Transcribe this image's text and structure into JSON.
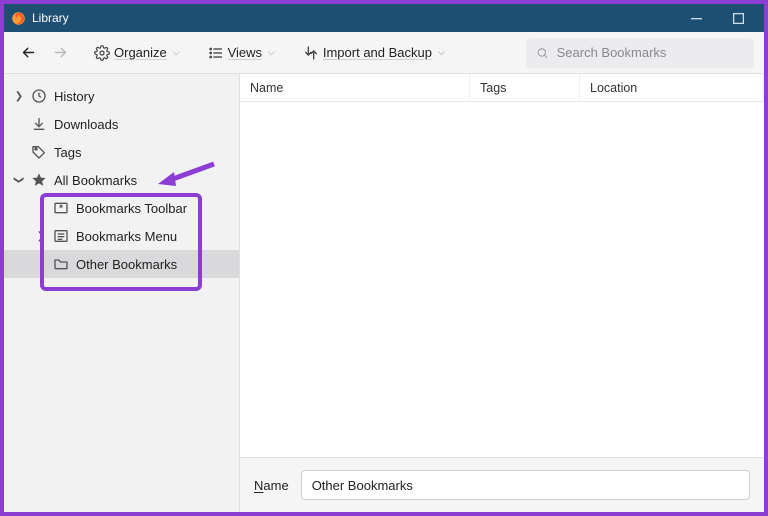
{
  "window": {
    "title": "Library"
  },
  "toolbar": {
    "organize": "Organize",
    "views": "Views",
    "import_backup": "Import and Backup"
  },
  "search": {
    "placeholder": "Search Bookmarks"
  },
  "sidebar": {
    "items": [
      {
        "label": "History"
      },
      {
        "label": "Downloads"
      },
      {
        "label": "Tags"
      },
      {
        "label": "All Bookmarks"
      }
    ],
    "bookmarks_children": [
      {
        "label": "Bookmarks Toolbar"
      },
      {
        "label": "Bookmarks Menu"
      },
      {
        "label": "Other Bookmarks"
      }
    ]
  },
  "columns": {
    "name": "Name",
    "tags": "Tags",
    "location": "Location"
  },
  "details": {
    "label": "Name",
    "value": "Other Bookmarks"
  }
}
